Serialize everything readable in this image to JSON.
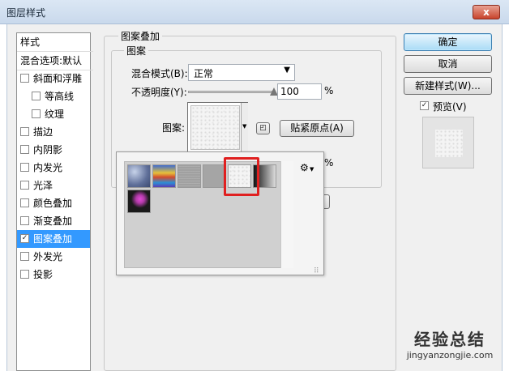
{
  "window": {
    "title": "图层样式",
    "close_label": "x"
  },
  "style_list": {
    "header": "样式",
    "blend_options": "混合选项:默认",
    "items": [
      {
        "label": "斜面和浮雕",
        "checked": false,
        "indent": false
      },
      {
        "label": "等高线",
        "checked": false,
        "indent": true
      },
      {
        "label": "纹理",
        "checked": false,
        "indent": true
      },
      {
        "label": "描边",
        "checked": false,
        "indent": false
      },
      {
        "label": "内阴影",
        "checked": false,
        "indent": false
      },
      {
        "label": "内发光",
        "checked": false,
        "indent": false
      },
      {
        "label": "光泽",
        "checked": false,
        "indent": false
      },
      {
        "label": "颜色叠加",
        "checked": false,
        "indent": false
      },
      {
        "label": "渐变叠加",
        "checked": false,
        "indent": false
      },
      {
        "label": "图案叠加",
        "checked": true,
        "indent": false,
        "selected": true
      },
      {
        "label": "外发光",
        "checked": false,
        "indent": false
      },
      {
        "label": "投影",
        "checked": false,
        "indent": false
      }
    ]
  },
  "panel": {
    "title": "图案叠加",
    "subtitle": "图案",
    "blend_mode_label": "混合模式(B):",
    "blend_mode_value": "正常",
    "opacity_label": "不透明度(Y):",
    "opacity_value": "100",
    "opacity_percent": 100,
    "percent_sign": "%",
    "pattern_label": "图案:",
    "snap_button": "贴紧原点(A)",
    "scale_percent_sign": "%"
  },
  "buttons": {
    "ok": "确定",
    "cancel": "取消",
    "new_style": "新建样式(W)...",
    "preview": "预览(V)",
    "preview_checked": true
  },
  "popup": {
    "gear_label": "⚙"
  },
  "watermark": {
    "main": "经验总结",
    "url": "jingyanzongjie.com"
  },
  "colors": {
    "selection": "#3399ff",
    "highlight": "#e02020"
  }
}
